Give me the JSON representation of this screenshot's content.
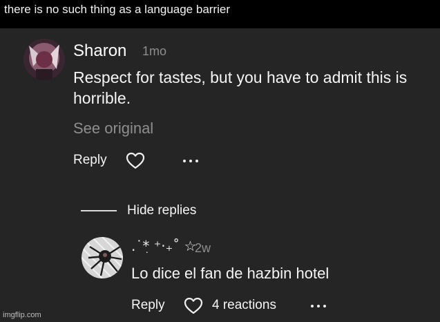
{
  "caption": "there is no such thing as a language barrier",
  "comment": {
    "author": "Sharon",
    "time": "1mo",
    "text": "Respect for tastes, but you have to admit this is horrible.",
    "see_original": "See original",
    "reply_label": "Reply"
  },
  "replies_toggle": "Hide replies",
  "reply": {
    "author": ".˙*ִ ⁺‧₊˚ ☆",
    "time": "2w",
    "text": "Lo dice el fan de hazbin hotel",
    "reply_label": "Reply",
    "reactions": "4 reactions"
  },
  "watermark": "imgflip.com"
}
